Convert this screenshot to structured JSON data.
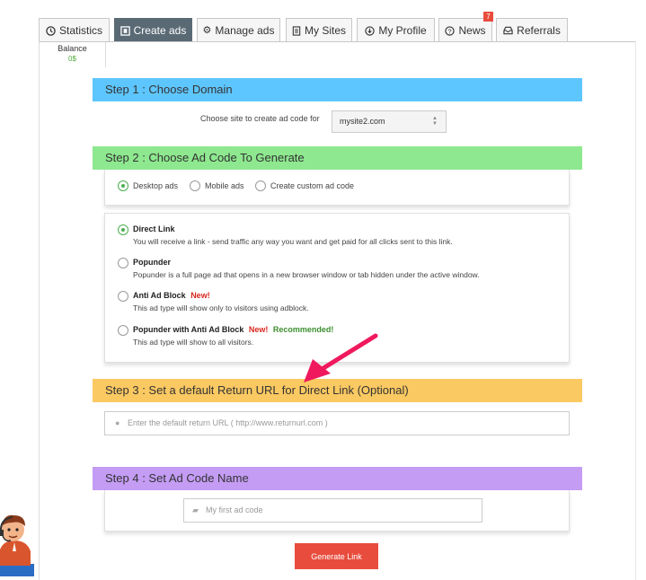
{
  "tabs": [
    {
      "label": "Statistics",
      "icon": "clock-icon",
      "active": false
    },
    {
      "label": "Create ads",
      "icon": "ad-icon",
      "active": true
    },
    {
      "label": "Manage ads",
      "icon": "gear-icon",
      "active": false
    },
    {
      "label": "My Sites",
      "icon": "document-icon",
      "active": false
    },
    {
      "label": "My Profile",
      "icon": "download-circle-icon",
      "active": false
    },
    {
      "label": "News",
      "icon": "question-icon",
      "active": false,
      "badge": "7"
    },
    {
      "label": "Referrals",
      "icon": "inbox-icon",
      "active": false
    }
  ],
  "balance": {
    "label": "Balance",
    "value": "0$"
  },
  "step1": {
    "title": "Step 1 : Choose Domain",
    "label": "Choose site to create ad code for",
    "selected": "mysite2.com"
  },
  "step2": {
    "title": "Step 2 : Choose Ad Code To Generate",
    "types": [
      {
        "label": "Desktop ads",
        "selected": true
      },
      {
        "label": "Mobile ads",
        "selected": false
      },
      {
        "label": "Create custom ad code",
        "selected": false
      }
    ],
    "options": [
      {
        "title": "Direct Link",
        "desc": "You will receive a link - send traffic any way you want and get paid for all clicks sent to this link.",
        "selected": true
      },
      {
        "title": "Popunder",
        "desc": "Popunder is a full page ad that opens in a new browser window or tab hidden under the active window.",
        "selected": false
      },
      {
        "title": "Anti Ad Block",
        "new": "New!",
        "desc": "This ad type will show only to visitors using adblock.",
        "selected": false
      },
      {
        "title": "Popunder with Anti Ad Block",
        "new": "New!",
        "recommended": "Recommended!",
        "desc": "This ad type will show to all visitors.",
        "selected": false
      }
    ]
  },
  "step3": {
    "title": "Step 3 : Set a default Return URL for Direct Link (Optional)",
    "placeholder": "Enter the default return URL ( http://www.returnurl.com )"
  },
  "step4": {
    "title": "Step 4 : Set Ad Code Name",
    "placeholder": "My first ad code"
  },
  "generate_button": "Generate Link",
  "colors": {
    "step1": "#5ec6ff",
    "step2": "#8ee88f",
    "step3": "#fbc962",
    "step4": "#c49cf4",
    "generate": "#e84c3d",
    "arrow": "#f0195d",
    "active_tab": "#5a6a75"
  }
}
